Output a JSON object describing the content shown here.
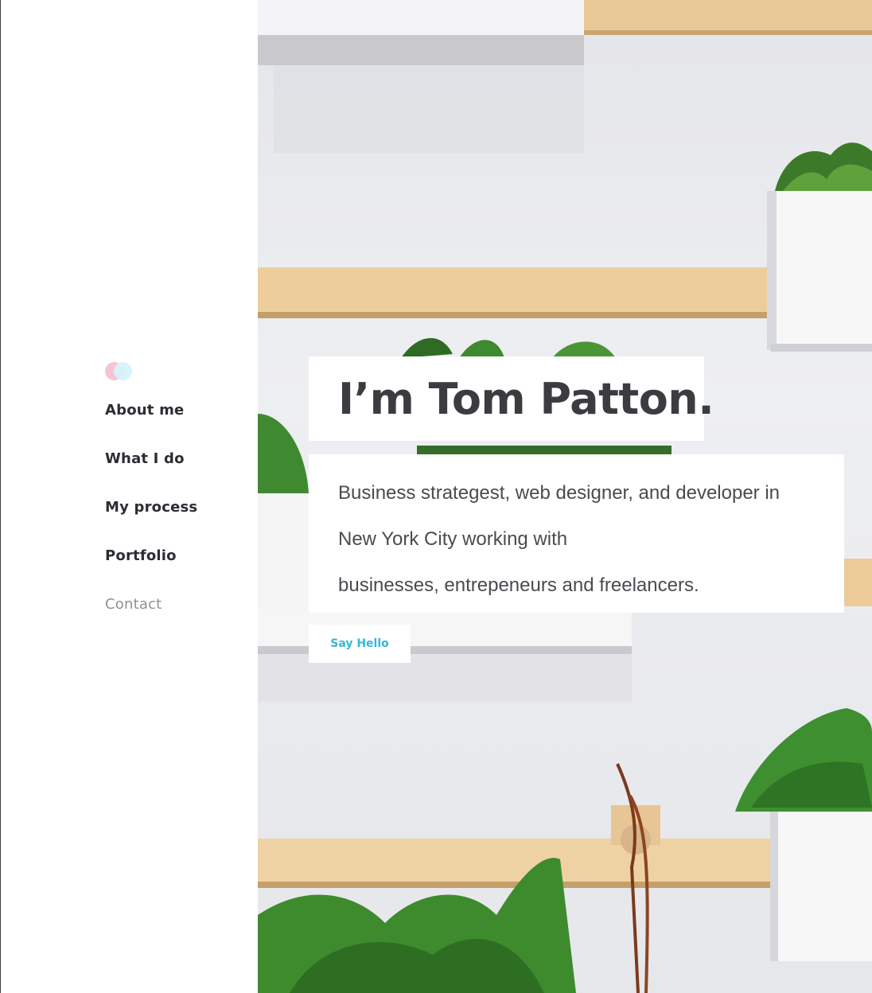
{
  "sidebar": {
    "logo_icon": "two-overlapping-circles-icon",
    "logo_colors": [
      "#f8c3d6",
      "#d6f3fb"
    ],
    "nav": [
      {
        "label": "About me"
      },
      {
        "label": "What I do"
      },
      {
        "label": "My process"
      },
      {
        "label": "Portfolio"
      },
      {
        "label": "Contact"
      }
    ]
  },
  "hero": {
    "title": "I’m Tom Patton.",
    "description": [
      "Business strategest, web designer, and developer in",
      "New York City working with",
      "businesses, entrepeneurs and freelancers."
    ],
    "cta_label": "Say Hello",
    "cta_color": "#37b6d6"
  }
}
